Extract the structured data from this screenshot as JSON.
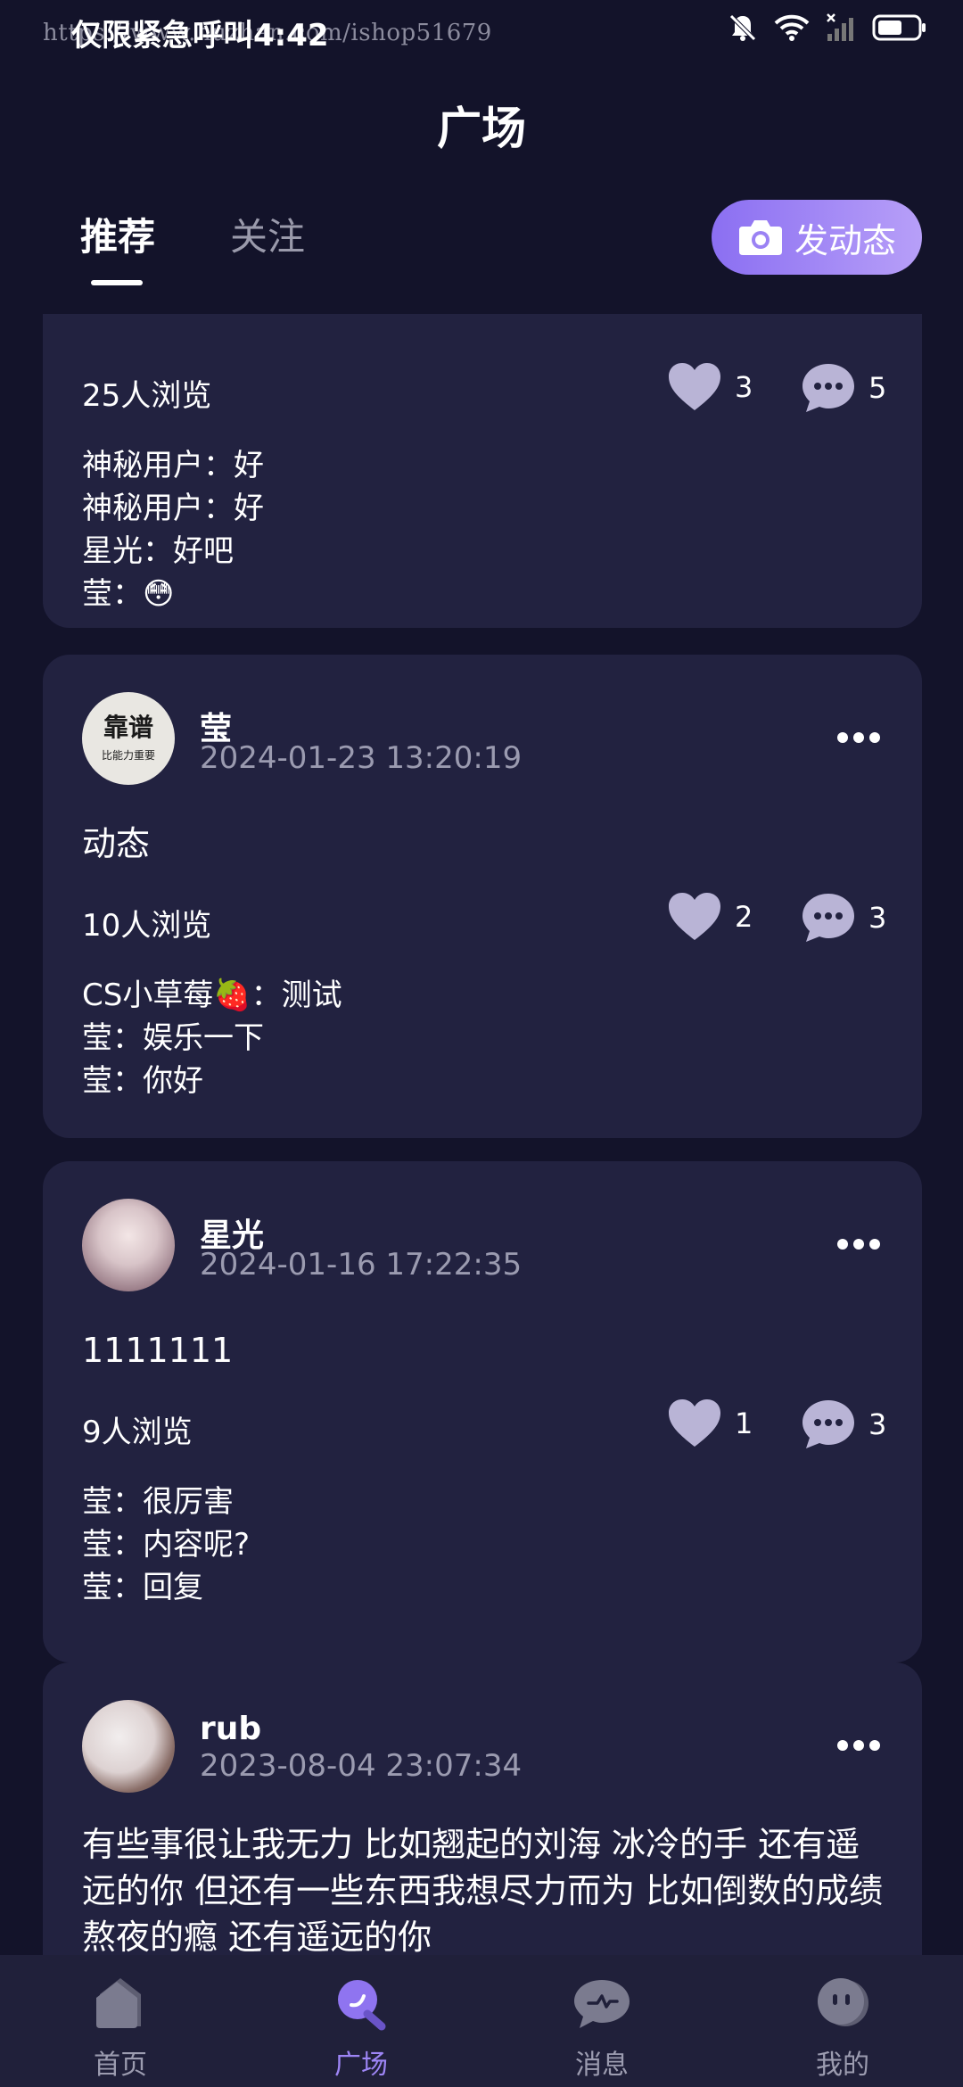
{
  "status_bar": {
    "url_watermark": "https://www.huzhan.com/ishop51679",
    "time_text": "仅限紧急呼叫4:42"
  },
  "header": {
    "title": "广场"
  },
  "tabs": [
    {
      "label": "推荐",
      "active": true
    },
    {
      "label": "关注",
      "active": false
    }
  ],
  "post_button": {
    "label": "发动态",
    "icon": "camera-icon"
  },
  "posts": [
    {
      "views": "25人浏览",
      "likes": "3",
      "comment_count": "5",
      "comments": [
        "神秘用户：好",
        "神秘用户：好",
        "星光：好吧",
        "莹：😳"
      ]
    },
    {
      "author": "莹",
      "avatar_text_line1": "靠谱",
      "avatar_text_line2": "比能力重要",
      "timestamp": "2024-01-23 13:20:19",
      "content": "动态",
      "views": "10人浏览",
      "likes": "2",
      "comment_count": "3",
      "comments": [
        "CS小草莓🍓：测试",
        "莹：娱乐一下",
        "莹：你好"
      ]
    },
    {
      "author": "星光",
      "timestamp": "2024-01-16 17:22:35",
      "content": "1111111",
      "views": "9人浏览",
      "likes": "1",
      "comment_count": "3",
      "comments": [
        "莹：很厉害",
        "莹：内容呢?",
        "莹：回复"
      ]
    },
    {
      "author": "rub",
      "timestamp": "2023-08-04 23:07:34",
      "content": "有些事很让我无力 比如翘起的刘海 冰冷的手 还有遥远的你 但还有一些东西我想尽力而为 比如倒数的成绩 熬夜的瘾 还有遥远的你"
    }
  ],
  "bottom_nav": [
    {
      "label": "首页",
      "icon": "home-icon",
      "active": false
    },
    {
      "label": "广场",
      "icon": "plaza-icon",
      "active": true
    },
    {
      "label": "消息",
      "icon": "message-icon",
      "active": false
    },
    {
      "label": "我的",
      "icon": "profile-icon",
      "active": false
    }
  ],
  "colors": {
    "background": "#13132a",
    "card": "#222240",
    "accent": "#9d85f5",
    "muted_text": "#9b9bb0",
    "icon_fill": "#b9b4d6"
  }
}
